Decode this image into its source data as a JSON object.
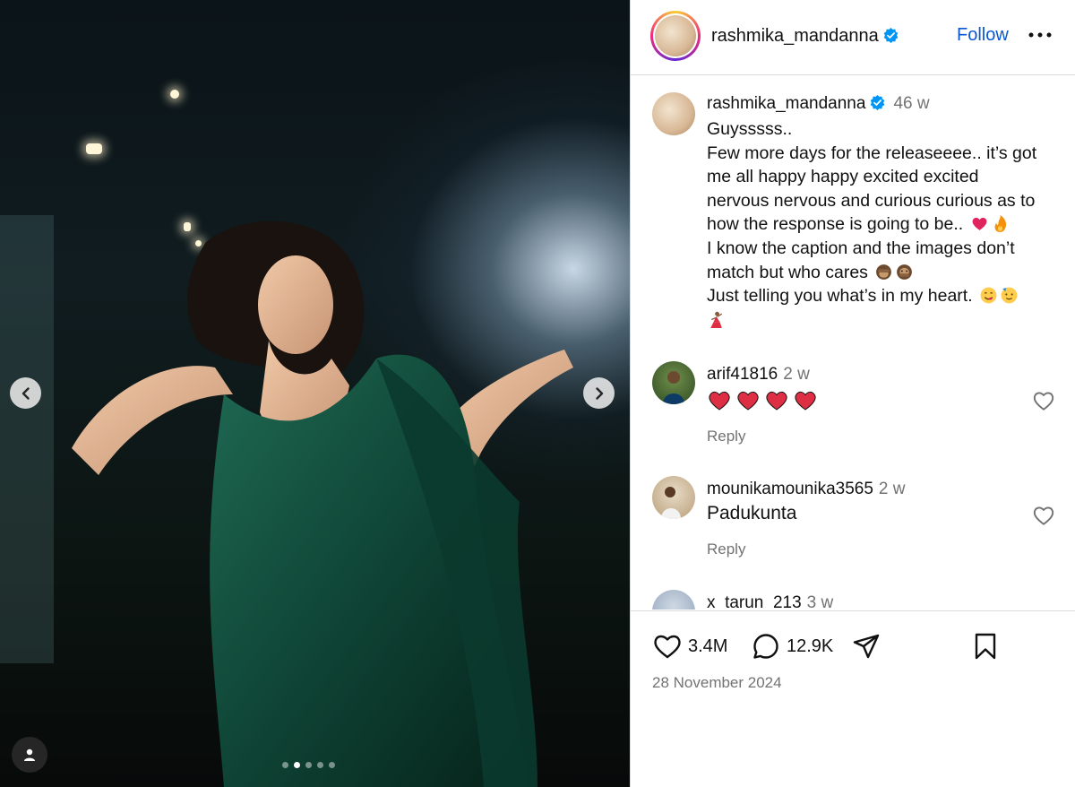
{
  "post": {
    "author": "rashmika_mandanna",
    "follow_label": "Follow",
    "caption_time": "46 w",
    "caption_lines": [
      "Guysssss..",
      "Few more days for the releaseeee.. it’s got",
      "me all happy happy excited excited",
      "nervous nervous and curious curious as to",
      "how the response is going to be.. ",
      "I know the caption and the images don’t",
      "match but who cares ",
      "Just telling you what’s in my heart. "
    ],
    "media": {
      "slide_count": 5,
      "active_slide": 2
    }
  },
  "comments": [
    {
      "user": "arif41816",
      "time": "2 w",
      "text": "❤️❤️❤️❤️",
      "reply_label": "Reply"
    },
    {
      "user": "mounikamounika3565",
      "time": "2 w",
      "text": "Padukunta",
      "reply_label": "Reply"
    },
    {
      "user": "x_tarun_213",
      "time": "3 w"
    }
  ],
  "actions": {
    "likes": "3.4M",
    "comments": "12.9K",
    "date": "28 November 2024"
  },
  "colors": {
    "accent_blue": "#0a58d0",
    "verified_blue": "#0095f6",
    "muted": "#737373",
    "heart_red": "#e0245e"
  },
  "icons": [
    "verified-icon",
    "more-icon",
    "heart-icon",
    "comment-icon",
    "share-icon",
    "bookmark-icon",
    "chevron-left-icon",
    "chevron-right-icon",
    "user-tag-icon"
  ]
}
